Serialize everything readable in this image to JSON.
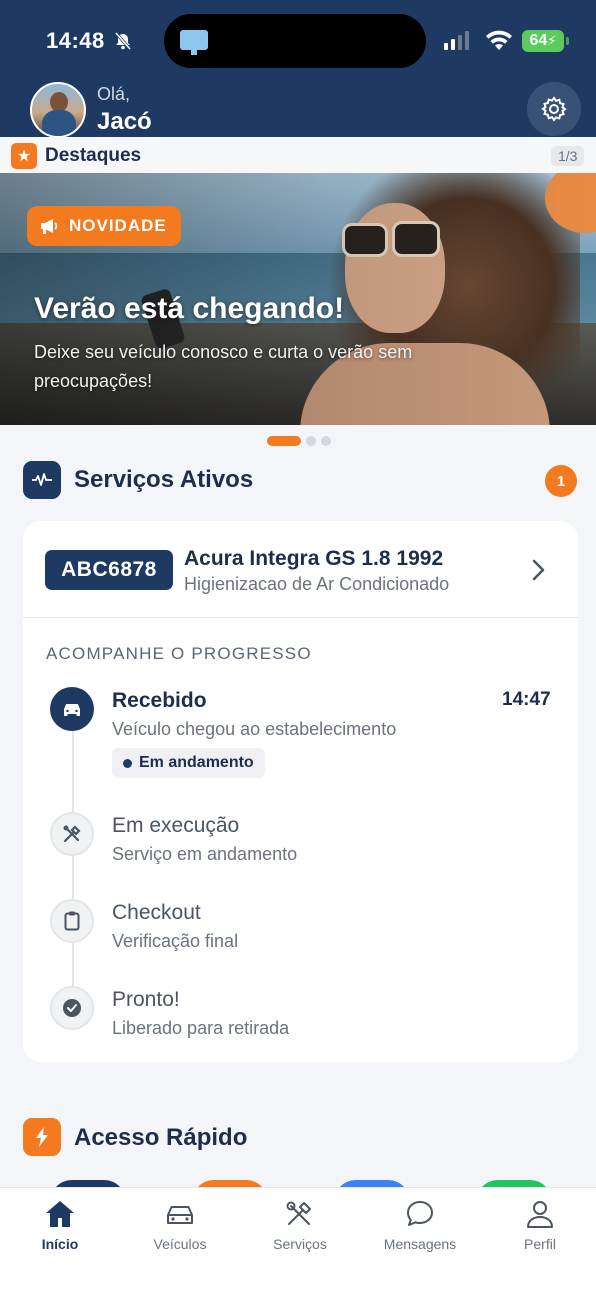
{
  "status_bar": {
    "time": "14:48",
    "battery": "64"
  },
  "header": {
    "greeting": "Olá,",
    "user_name": "Jacó"
  },
  "highlights": {
    "label": "Destaques",
    "counter": "1/3"
  },
  "banner": {
    "badge": "NOVIDADE",
    "title": "Verão está chegando!",
    "text": "Deixe seu veículo conosco e curta o verão sem preocupações!"
  },
  "active_services": {
    "title": "Serviços Ativos",
    "count": "1",
    "vehicle": {
      "plate": "ABC6878",
      "name": "Acura Integra GS 1.8 1992",
      "service": "Higienizacao de Ar Condicionado"
    },
    "progress_label": "ACOMPANHE O PROGRESSO",
    "steps": [
      {
        "title": "Recebido",
        "desc": "Veículo chegou ao estabelecimento",
        "time": "14:47",
        "status": "Em andamento"
      },
      {
        "title": "Em execução",
        "desc": "Serviço em andamento"
      },
      {
        "title": "Checkout",
        "desc": "Verificação final"
      },
      {
        "title": "Pronto!",
        "desc": "Liberado para retirada"
      }
    ]
  },
  "quick_access": {
    "title": "Acesso Rápido"
  },
  "bottom_nav": [
    {
      "label": "Início",
      "icon": "home-icon"
    },
    {
      "label": "Veículos",
      "icon": "car-icon"
    },
    {
      "label": "Serviços",
      "icon": "tools-icon"
    },
    {
      "label": "Mensagens",
      "icon": "chat-icon"
    },
    {
      "label": "Perfil",
      "icon": "user-icon"
    }
  ],
  "colors": {
    "brand_navy": "#1e3a63",
    "accent_orange": "#f47a20",
    "ok_green": "#5ccb5f",
    "quick_blue": "#3b82f6",
    "quick_green": "#22c55e"
  }
}
